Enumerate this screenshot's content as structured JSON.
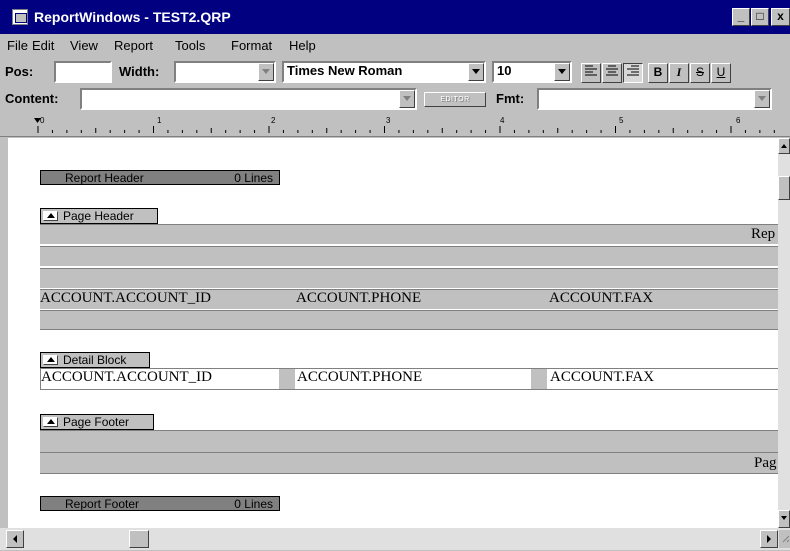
{
  "window": {
    "title": "ReportWindows - TEST2.QRP"
  },
  "menu": [
    "File",
    "Edit",
    "View",
    "Report",
    "Tools",
    "Format",
    "Help"
  ],
  "toolbar1": {
    "pos_label": "Pos:",
    "pos_value": "",
    "width_label": "Width:",
    "width_value": "",
    "font": "Times New Roman",
    "font_size": "10",
    "bold": "B",
    "italic": "I",
    "strike": "S",
    "underline": "U"
  },
  "toolbar2": {
    "content_label": "Content:",
    "content_value": "",
    "editor": "EDITOR",
    "fmt_label": "Fmt:",
    "fmt_value": ""
  },
  "ruler": [
    "0",
    "1",
    "2",
    "3",
    "4",
    "5",
    "6"
  ],
  "bands": {
    "report_header": {
      "name": "Report Header",
      "lines": "0 Lines"
    },
    "page_header": {
      "name": "Page Header",
      "text": "Rep"
    },
    "fields": [
      "ACCOUNT.ACCOUNT_ID",
      "ACCOUNT.PHONE",
      "ACCOUNT.FAX"
    ],
    "detail_block": {
      "name": "Detail Block"
    },
    "page_footer": {
      "name": "Page Footer",
      "text": "Pag"
    },
    "report_footer": {
      "name": "Report Footer",
      "lines": "0 Lines"
    }
  },
  "colors": {
    "titlebar": "#000080",
    "chrome": "#c0c0c0",
    "band": "#808080"
  }
}
